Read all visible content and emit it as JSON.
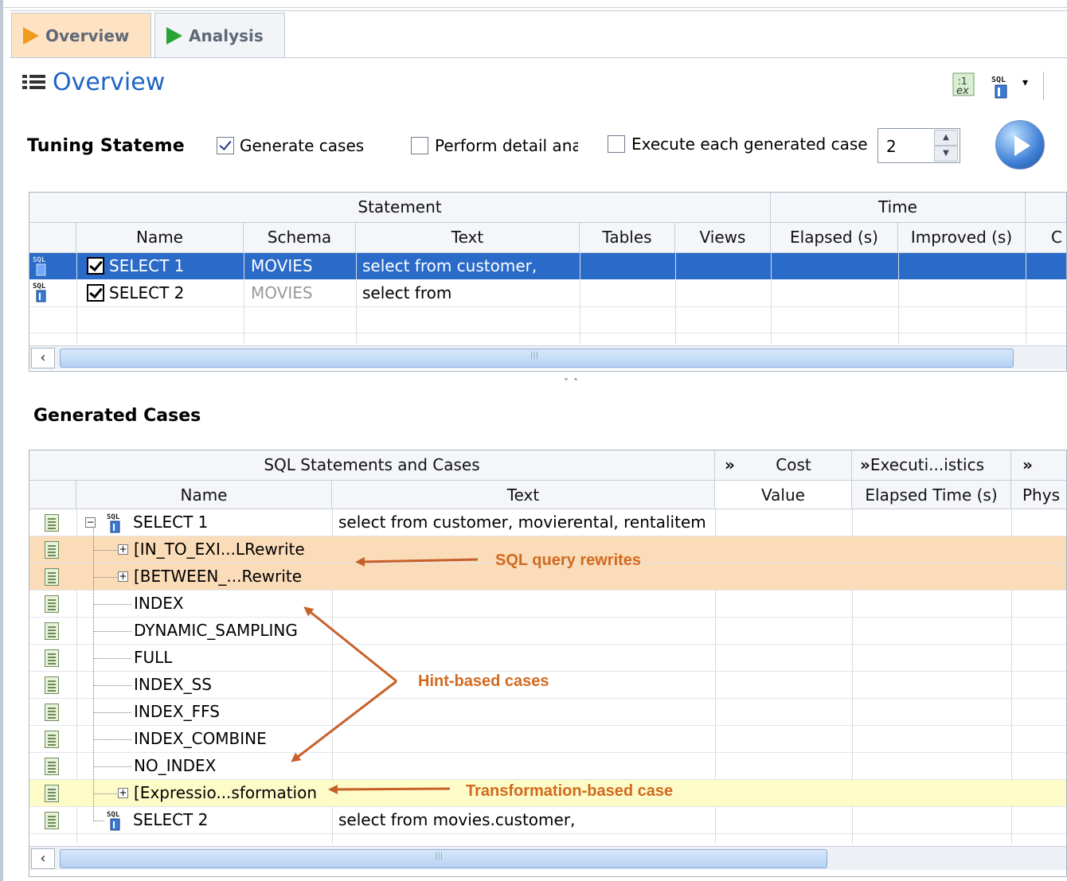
{
  "tabs": [
    {
      "label": "Overview",
      "icon": "orange-triangle-icon",
      "active": true
    },
    {
      "label": "Analysis",
      "icon": "green-triangle-icon",
      "active": false
    }
  ],
  "header": {
    "title": "Overview"
  },
  "options": {
    "label": "Tuning Stateme",
    "generate_cases": "Generate cases",
    "detail_analysis": "Perform detail ana",
    "execute_each": "Execute each generated case",
    "spinner_value": "2"
  },
  "statements": {
    "group_statement": "Statement",
    "group_time": "Time",
    "columns": [
      "Name",
      "Schema",
      "Text",
      "Tables",
      "Views",
      "Elapsed (s)",
      "Improved (s)",
      "C"
    ],
    "rows": [
      {
        "name": "SELECT 1",
        "schema": "MOVIES",
        "text": "select from customer,",
        "selected": true,
        "checked": true
      },
      {
        "name": "SELECT 2",
        "schema": "MOVIES",
        "text": "select from",
        "selected": false,
        "checked": true
      }
    ]
  },
  "generated": {
    "title": "Generated Cases",
    "group_sql": "SQL Statements and Cases",
    "group_cost": "Cost",
    "group_exec": "Executi...istics",
    "columns": [
      "Name",
      "Text",
      "Value",
      "Elapsed Time (s)",
      "Phys"
    ],
    "rows": [
      {
        "name": "SELECT 1",
        "text": "select from customer, movierental, rentalitem",
        "kind": "root"
      },
      {
        "name": "[IN_TO_EXI...LRewrite",
        "text": "",
        "kind": "rewrite"
      },
      {
        "name": "[BETWEEN_...Rewrite",
        "text": "",
        "kind": "rewrite"
      },
      {
        "name": "INDEX",
        "text": "",
        "kind": "hint"
      },
      {
        "name": "DYNAMIC_SAMPLING",
        "text": "",
        "kind": "hint"
      },
      {
        "name": "FULL",
        "text": "",
        "kind": "hint"
      },
      {
        "name": "INDEX_SS",
        "text": "",
        "kind": "hint"
      },
      {
        "name": "INDEX_FFS",
        "text": "",
        "kind": "hint"
      },
      {
        "name": "INDEX_COMBINE",
        "text": "",
        "kind": "hint"
      },
      {
        "name": "NO_INDEX",
        "text": "",
        "kind": "hint"
      },
      {
        "name": "[Expressio...sformation",
        "text": "",
        "kind": "transform"
      },
      {
        "name": "SELECT 2",
        "text": "select from movies.customer,",
        "kind": "root"
      }
    ]
  },
  "annotations": {
    "rewrites": "SQL query rewrites",
    "hints": "Hint-based cases",
    "transform": "Transformation-based case"
  },
  "colors": {
    "accent": "#1f63c5",
    "selected_row": "#2a6ac8",
    "rewrite_row": "#fbdcb8",
    "transform_row": "#fdfbc8",
    "annotation": "#d2691e"
  }
}
